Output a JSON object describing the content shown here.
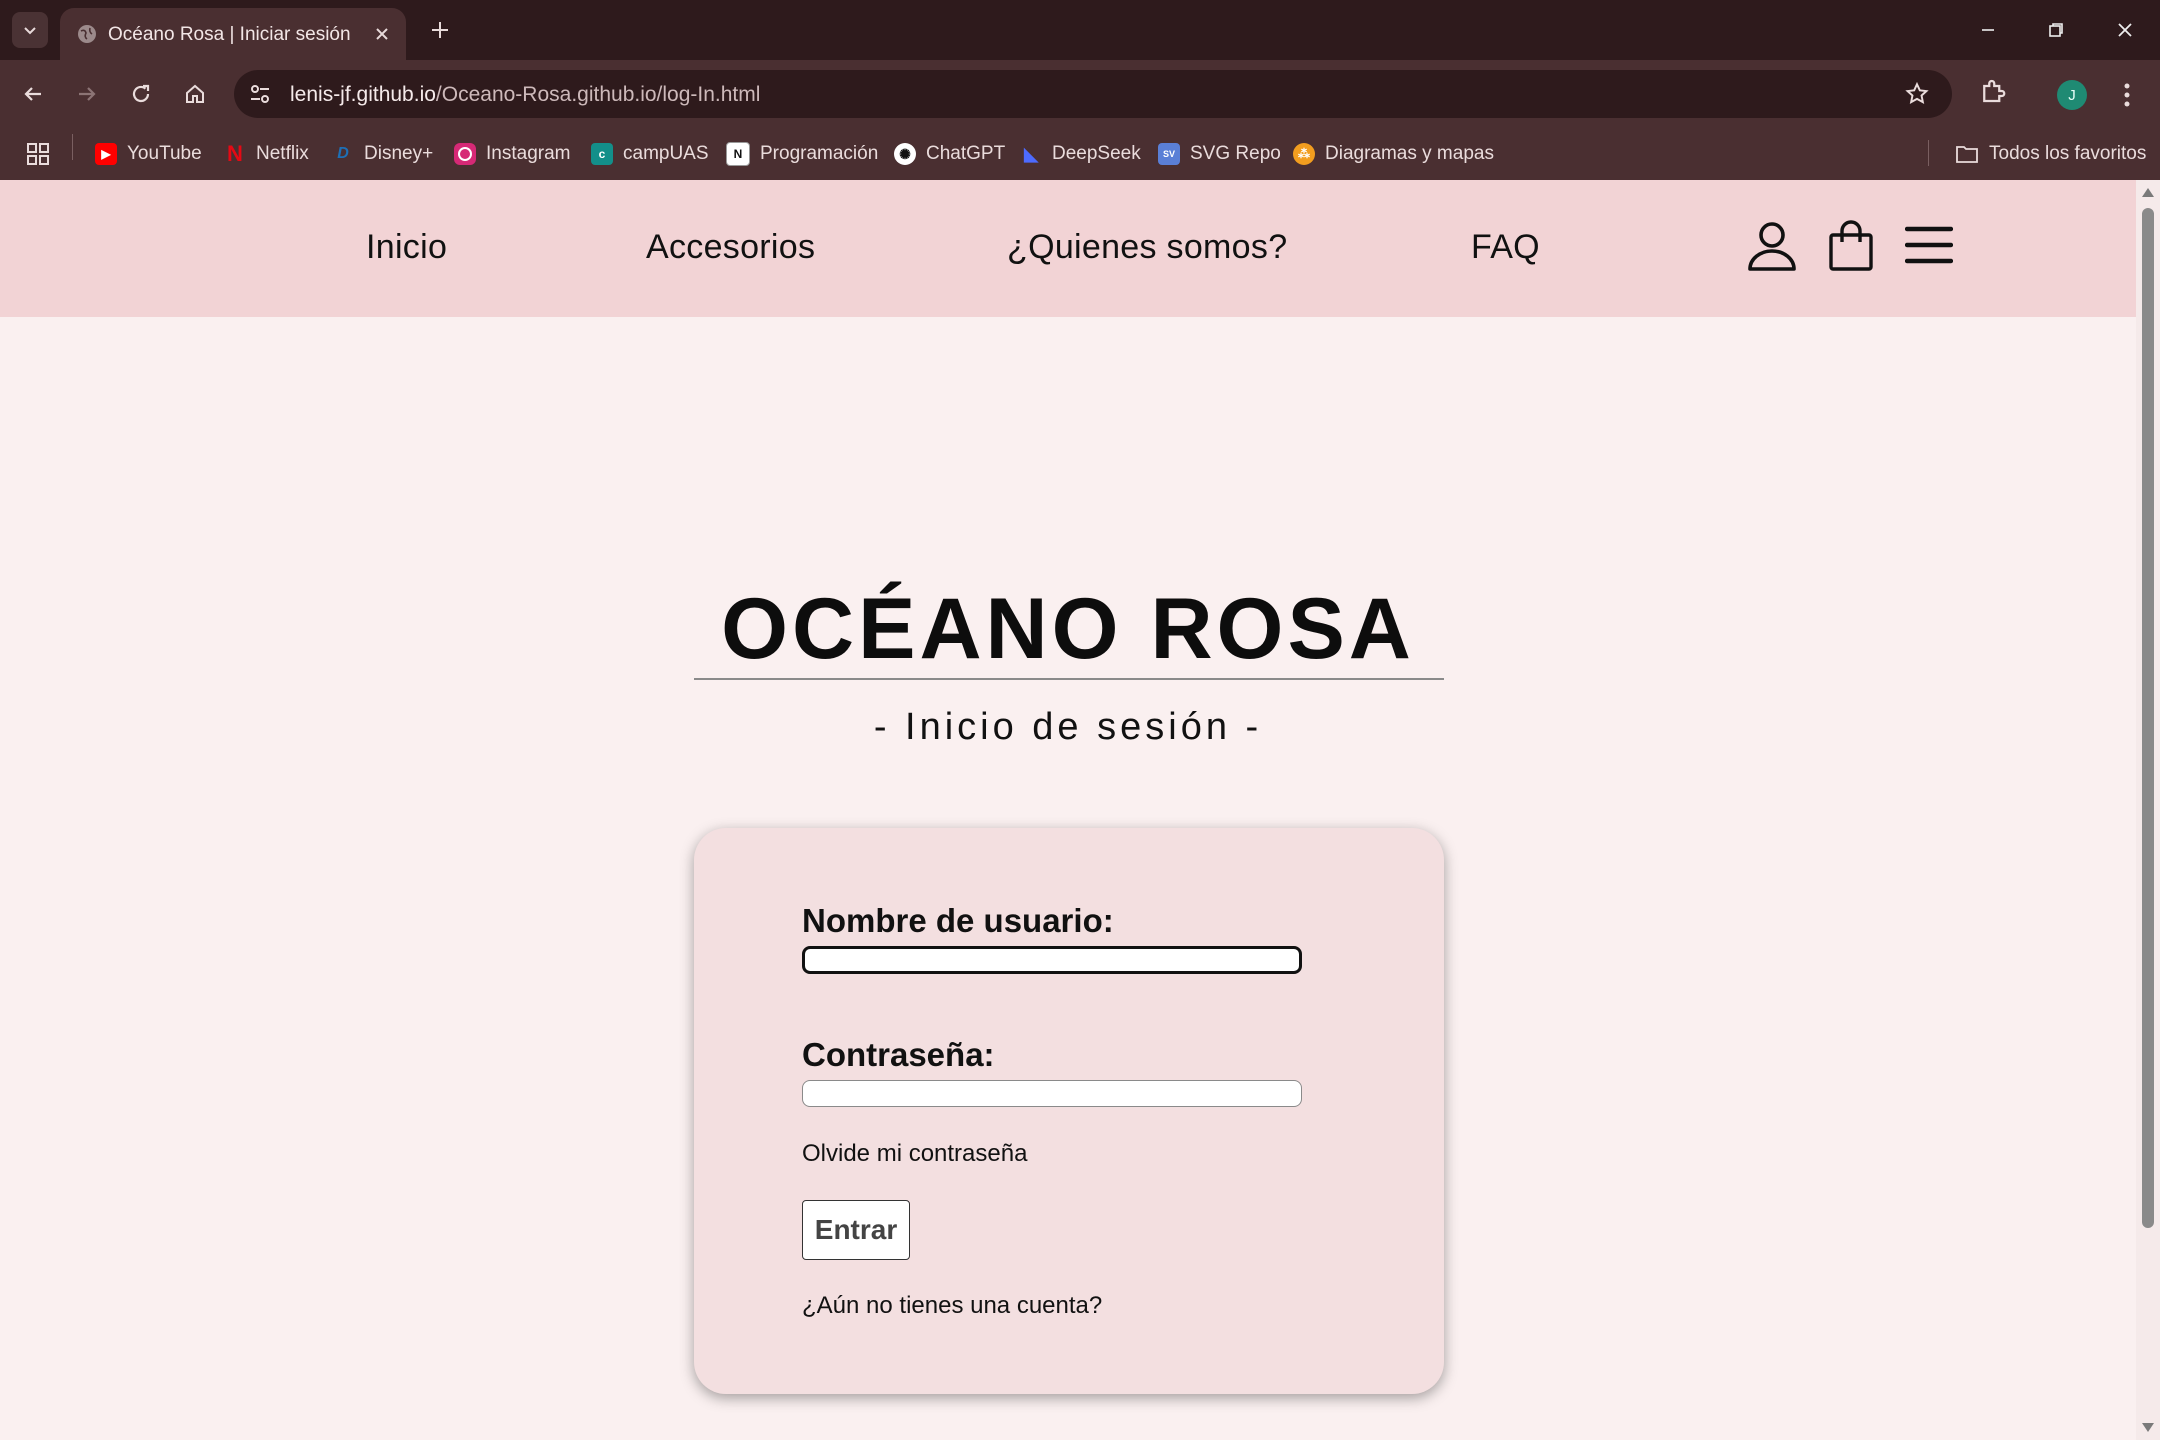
{
  "browser": {
    "tab_title": "Océano Rosa | Iniciar sesión",
    "url_host": "lenis-jf.github.io",
    "url_path": "/Oceano-Rosa.github.io/log-In.html",
    "profile_initial": "J",
    "bookmarks": [
      {
        "label": "YouTube",
        "icon": "youtube-icon",
        "color": "#ff0000"
      },
      {
        "label": "Netflix",
        "icon": "netflix-icon",
        "color": "#e50914"
      },
      {
        "label": "Disney+",
        "icon": "disney-icon",
        "color": "#1e6fb5"
      },
      {
        "label": "Instagram",
        "icon": "instagram-icon",
        "color": "#d62976"
      },
      {
        "label": "campUAS",
        "icon": "campuas-icon",
        "color": "#138f8a"
      },
      {
        "label": "Programación",
        "icon": "notion-icon",
        "color": "#ffffff"
      },
      {
        "label": "ChatGPT",
        "icon": "chatgpt-icon",
        "color": "#ffffff"
      },
      {
        "label": "DeepSeek",
        "icon": "deepseek-icon",
        "color": "#4d6bfe"
      },
      {
        "label": "SVG Repo",
        "icon": "svgrepo-icon",
        "color": "#5a7fd6"
      },
      {
        "label": "Diagramas y mapas",
        "icon": "diagrams-icon",
        "color": "#f29d1f"
      }
    ],
    "all_bookmarks": "Todos los favoritos"
  },
  "site": {
    "nav": {
      "inicio": "Inicio",
      "accesorios": "Accesorios",
      "quienes": "¿Quienes somos?",
      "faq": "FAQ"
    },
    "brand": "OCÉANO ROSA",
    "subtitle": "- Inicio de sesión -",
    "form": {
      "username_label": "Nombre de usuario:",
      "username_value": "",
      "password_label": "Contraseña:",
      "password_value": "",
      "forgot": "Olvide mi contraseña",
      "submit": "Entrar",
      "register": "¿Aún no tienes una cuenta?"
    }
  },
  "colors": {
    "chrome_dark": "#2e1a1c",
    "chrome_mid": "#4a2f31",
    "nav_bg": "#f2d3d5",
    "page_bg": "#faf0f0",
    "card_bg": "#f3dfe0"
  }
}
